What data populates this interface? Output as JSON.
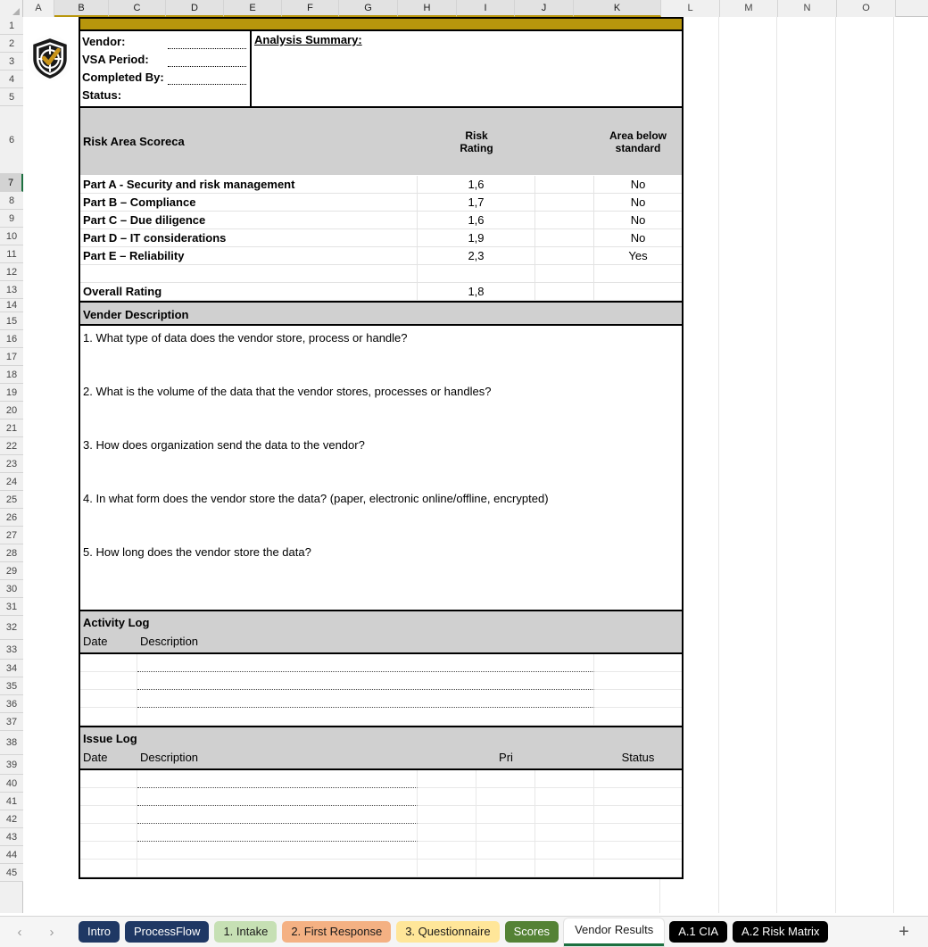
{
  "spreadsheet": {
    "columns": [
      "A",
      "B",
      "C",
      "D",
      "E",
      "F",
      "G",
      "H",
      "I",
      "J",
      "K",
      "L",
      "M",
      "N",
      "O"
    ],
    "selected_columns": [
      "B",
      "C",
      "D",
      "E",
      "F",
      "G",
      "H",
      "I",
      "J",
      "K"
    ],
    "rows": [
      "1",
      "2",
      "3",
      "4",
      "5",
      "6",
      "7",
      "8",
      "9",
      "10",
      "11",
      "12",
      "13",
      "14",
      "15",
      "16",
      "17",
      "18",
      "19",
      "20",
      "21",
      "22",
      "23",
      "24",
      "25",
      "26",
      "27",
      "28",
      "29",
      "30",
      "31",
      "32",
      "33",
      "34",
      "35",
      "36",
      "37",
      "38",
      "39",
      "40",
      "41",
      "42",
      "43",
      "44",
      "45"
    ],
    "active_row": "7"
  },
  "logo": {
    "name": "shield-check-logo",
    "shield_color": "#1a1a1a",
    "check_color": "#c9941a"
  },
  "header": {
    "fields": [
      {
        "label": "Vendor:",
        "value": ""
      },
      {
        "label": "VSA Period:",
        "value": ""
      },
      {
        "label": "Completed By:",
        "value": ""
      },
      {
        "label": "Status:",
        "value": ""
      }
    ],
    "analysis_summary_label": "Analysis Summary:",
    "analysis_summary_value": ""
  },
  "scorecard": {
    "title": "Risk Area Scoreca",
    "col_risk_rating": "Risk\nRating",
    "col_risk_rating_line1": "Risk",
    "col_risk_rating_line2": "Rating",
    "col_area_below": "Area below standard",
    "col_area_below_line1": "Area below",
    "col_area_below_line2": "standard",
    "rows": [
      {
        "label": "Part A - Security and risk management",
        "rating": "1,6",
        "below_standard": "No"
      },
      {
        "label": "Part B – Compliance",
        "rating": "1,7",
        "below_standard": "No"
      },
      {
        "label": "Part C – Due diligence",
        "rating": "1,6",
        "below_standard": "No"
      },
      {
        "label": "Part D – IT considerations",
        "rating": "1,9",
        "below_standard": "No"
      },
      {
        "label": "Part E – Reliability",
        "rating": "2,3",
        "below_standard": "Yes"
      }
    ],
    "overall_label": "Overall Rating",
    "overall_rating": "1,8"
  },
  "vendor_description": {
    "banner": "Vender Description",
    "questions": [
      "1. What type of data does the vendor store, process or handle?",
      "2. What is the volume of the data that the vendor stores, processes or handles?",
      "3. How does organization send the data to the vendor?",
      "4. In what form does the vendor store the data? (paper, electronic online/offline, encrypted)",
      "5. How long does the vendor store the data?"
    ]
  },
  "activity_log": {
    "banner": "Activity Log",
    "columns": {
      "date": "Date",
      "description": "Description"
    },
    "entries": []
  },
  "issue_log": {
    "banner": "Issue Log",
    "columns": {
      "date": "Date",
      "description": "Description",
      "priority": "Pri",
      "status": "Status"
    },
    "entries": []
  },
  "tabbar": {
    "prev_arrow": "‹",
    "next_arrow": "›",
    "add_sheet": "+",
    "tabs": [
      {
        "label": "Intro",
        "bg": "#1f3864",
        "fg": "#ffffff",
        "active": false
      },
      {
        "label": "ProcessFlow",
        "bg": "#1f3864",
        "fg": "#ffffff",
        "active": false
      },
      {
        "label": "1. Intake",
        "bg": "#c6e0b4",
        "fg": "#1a1a1a",
        "active": false
      },
      {
        "label": "2. First Response",
        "bg": "#f4b183",
        "fg": "#1a1a1a",
        "active": false
      },
      {
        "label": "3. Questionnaire",
        "bg": "#ffe699",
        "fg": "#1a1a1a",
        "active": false
      },
      {
        "label": "Scores",
        "bg": "#548235",
        "fg": "#ffffff",
        "active": false
      },
      {
        "label": "Vendor Results",
        "bg": "#ffffff",
        "fg": "#1a1a1a",
        "active": true
      },
      {
        "label": "A.1 CIA",
        "bg": "#000000",
        "fg": "#ffffff",
        "active": false
      },
      {
        "label": "A.2 Risk Matrix",
        "bg": "#000000",
        "fg": "#ffffff",
        "active": false
      }
    ]
  },
  "colors": {
    "gold_band": "#b8960c",
    "header_gray": "#d0d0d0",
    "active_tab_underline": "#1d7040"
  }
}
